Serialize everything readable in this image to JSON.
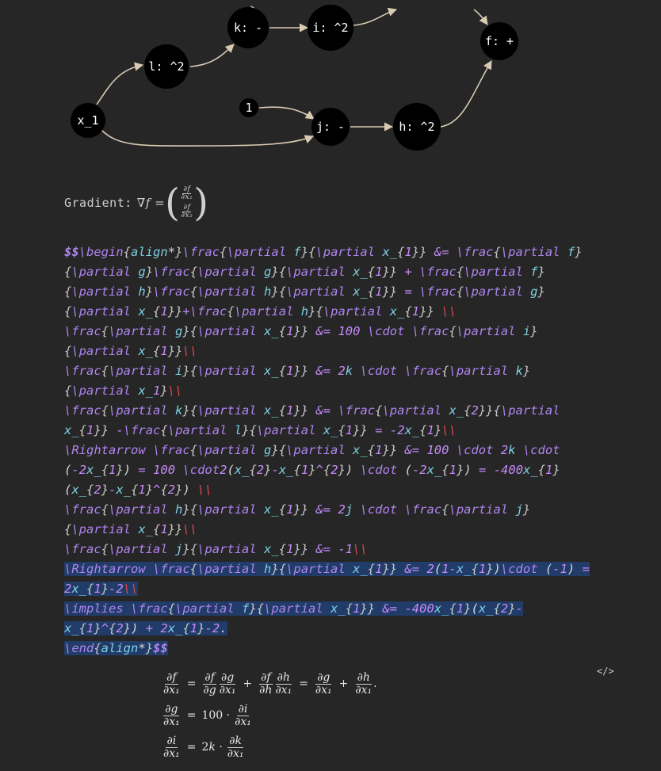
{
  "graph": {
    "nodes": [
      {
        "id": "x1",
        "label": "x_1"
      },
      {
        "id": "l",
        "label": "l: ^2"
      },
      {
        "id": "k",
        "label": "k: -"
      },
      {
        "id": "i",
        "label": "i: ^2"
      },
      {
        "id": "f",
        "label": "f: +"
      },
      {
        "id": "one",
        "label": "1"
      },
      {
        "id": "j",
        "label": "j: -"
      },
      {
        "id": "h",
        "label": "h: ^2"
      }
    ],
    "node_color": "#000000",
    "edge_color": "#d9cbb3"
  },
  "gradient": {
    "label": "Gradient:",
    "formula": "∇f =",
    "entries": [
      {
        "num": "∂f",
        "den": "∂x₁"
      },
      {
        "num": "∂f",
        "den": "∂x₂"
      }
    ]
  },
  "code_lines": [
    "$$\\begin{align*}\\frac{\\partial f}{\\partial x_{1}} &= \\frac{\\partial f}",
    "{\\partial g}\\frac{\\partial g}{\\partial x_{1}} + \\frac{\\partial f}",
    "{\\partial h}\\frac{\\partial h}{\\partial x_{1}} = \\frac{\\partial g}",
    "{\\partial x_{1}}+\\frac{\\partial h}{\\partial x_{1}} \\\\",
    "\\frac{\\partial g}{\\partial x_{1}} &= 100 \\cdot \\frac{\\partial i}",
    "{\\partial x_{1}}\\\\",
    "\\frac{\\partial i}{\\partial x_{1}} &= 2k \\cdot \\frac{\\partial k}",
    "{\\partial x_1}\\\\",
    "\\frac{\\partial k}{\\partial x_{1}} &= \\frac{\\partial x_{2}}{\\partial",
    "x_{1}} -\\frac{\\partial l}{\\partial x_{1}} = -2x_{1}\\\\",
    "\\Rightarrow \\frac{\\partial g}{\\partial x_{1}} &= 100 \\cdot 2k \\cdot",
    "(-2x_{1}) = 100 \\cdot2(x_{2}-x_{1}^{2}) \\cdot (-2x_{1}) = -400x_{1}",
    "(x_{2}-x_{1}^{2}) \\\\",
    "\\frac{\\partial h}{\\partial x_{1}} &= 2j \\cdot \\frac{\\partial j}",
    "{\\partial x_{1}}\\\\",
    "\\frac{\\partial j}{\\partial x_{1}} &= -1\\\\",
    "\\Rightarrow \\frac{\\partial h}{\\partial x_{1}} &= 2(1-x_{1})\\cdot (-1) =",
    "2x_{1}-2\\\\",
    "\\implies \\frac{\\partial f}{\\partial x_{1}} &= -400x_{1}(x_{2}-",
    "x_{1}^{2}) + 2x_{1}-2.",
    "\\end{align*}$$"
  ],
  "rendered": {
    "rows": [
      {
        "lhs_num": "∂f",
        "lhs_den": "∂x₁",
        "rhs": "= ∂f/∂g · ∂g/∂x₁ + ∂f/∂h · ∂h/∂x₁ = ∂g/∂x₁ + ∂h/∂x₁."
      },
      {
        "lhs_num": "∂g",
        "lhs_den": "∂x₁",
        "rhs": "= 100 · ∂i/∂x₁"
      },
      {
        "lhs_num": "∂i",
        "lhs_den": "∂x₁",
        "rhs": "= 2k · ∂k/∂x₁"
      }
    ],
    "code_toggle_icon": "</>"
  }
}
